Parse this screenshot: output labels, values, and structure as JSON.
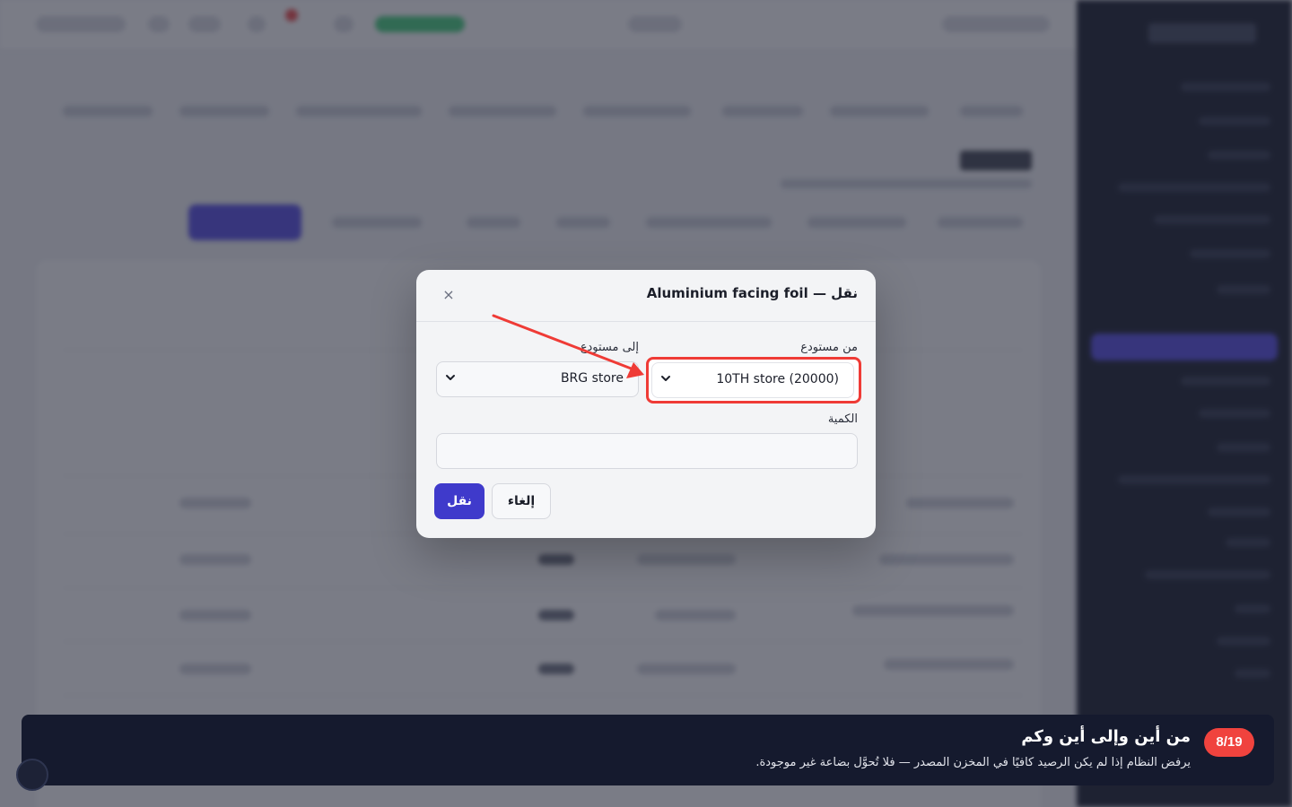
{
  "modal": {
    "title": "نقل — Aluminium facing foil",
    "close_label": "×",
    "from_label": "من مستودع",
    "from_value": "10TH store (20000)",
    "to_label": "إلى مستودع",
    "to_value": "BRG store",
    "quantity_label": "الكمية",
    "quantity_value": "",
    "cancel_label": "إلغاء",
    "transfer_label": "نقل"
  },
  "tour": {
    "step": "8/19",
    "title": "من أين وإلى أين وكم",
    "description": "يرفض النظام إذا لم يكن الرصيد كافيًا في المخزن المصدر — فلا تُحوَّل بضاعة غير موجودة."
  },
  "colors": {
    "primary": "#3f3acb",
    "highlight": "#ef3b36",
    "tour_bg": "#151a2e",
    "sidebar_bg": "#0f1424"
  }
}
